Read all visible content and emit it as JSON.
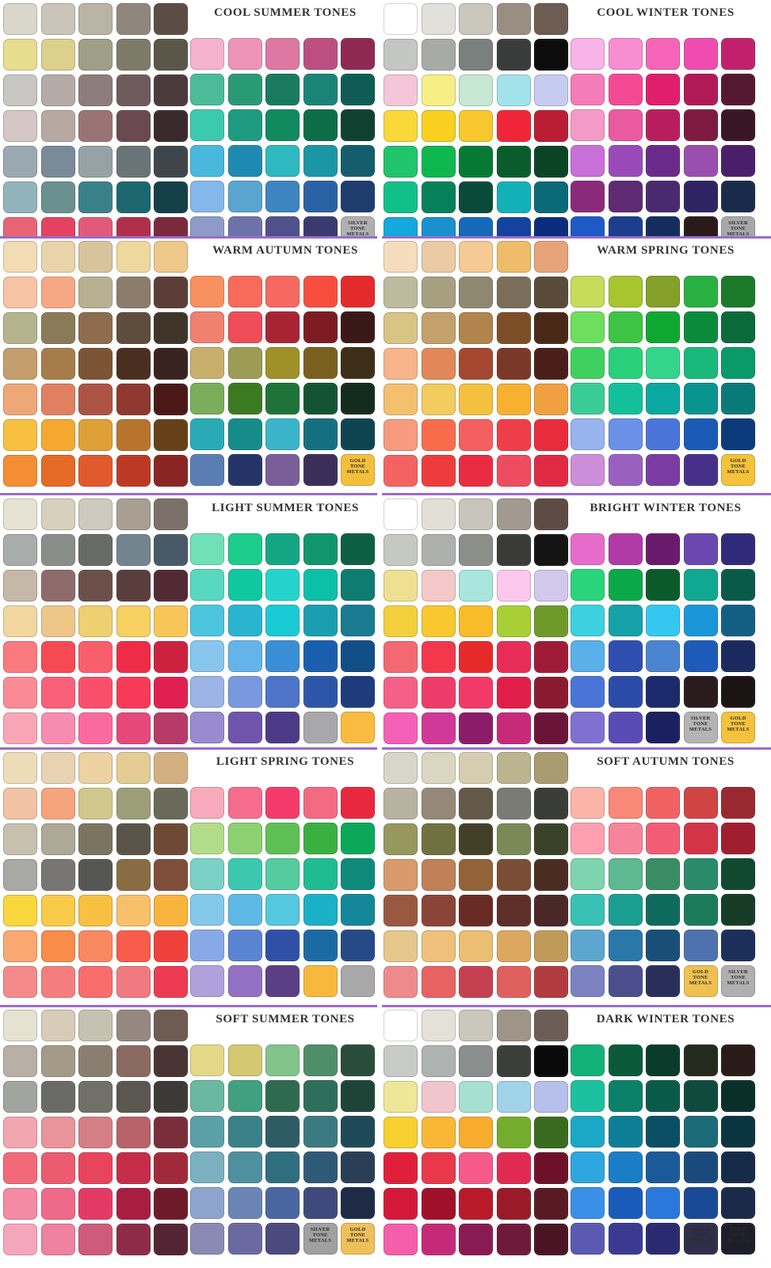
{
  "palettes": [
    {
      "title": "COOL SUMMER TONES",
      "left": [
        [
          "#d9d6cc",
          "#cac5b8",
          "#b9b4a4",
          "#8f877c",
          "#5b4d44"
        ],
        [
          "#e7dd8e",
          "#ddd08c",
          "#9e9f86",
          "#7c7a69",
          "#5a5748"
        ],
        [
          "#c8c6c2",
          "#b4aaa6",
          "#8c7c7c",
          "#6e5a5c",
          "#4a3a3c"
        ],
        [
          "#d6c6c6",
          "#b8a8a2",
          "#9a7474",
          "#6a4a50",
          "#3a2a2e"
        ],
        [
          "#9aa8b0",
          "#7a8a98",
          "#95a3a6",
          "#6a7478",
          "#3e464c"
        ],
        [
          "#90b4ba",
          "#6a9090",
          "#3a8088",
          "#1c6670",
          "#143e48"
        ],
        [
          "#e86474",
          "#e44260",
          "#e15a7a",
          "#b0304c",
          "#7a2a3c"
        ]
      ],
      "right": [
        [
          "#f4b2cc",
          "#ee94b8",
          "#dc78a2",
          "#bc4e80",
          "#8e2a52"
        ],
        [
          "#4cbc98",
          "#2a9a74",
          "#1a7a60",
          "#1a8478",
          "#0e5c54"
        ],
        [
          "#3ccaae",
          "#1e9a80",
          "#108a5e",
          "#0c6e48",
          "#104030"
        ],
        [
          "#48b8dc",
          "#1e8ab4",
          "#2eb8c0",
          "#1a96a4",
          "#145e6c"
        ],
        [
          "#84b8ea",
          "#5aa4d0",
          "#3e84c0",
          "#2a62a6",
          "#1e3c6e"
        ],
        [
          "#8e9ac8",
          "#6e72aa",
          "#50508a",
          "#3a3a6e",
          "#b0b0b0"
        ]
      ],
      "metals": [
        "",
        "",
        "",
        "",
        "SILVER TONE METALS"
      ]
    },
    {
      "title": "COOL WINTER TONES",
      "left": [
        [
          "#ffffff",
          "#e2e0da",
          "#cac8bc",
          "#9a8e82",
          "#6c5c52"
        ],
        [
          "#c4c6c4",
          "#a8aaa8",
          "#7a807e",
          "#3a3c3c",
          "#0c0c0c"
        ],
        [
          "#f4c6d8",
          "#f8ee86",
          "#c6e8d2",
          "#a2e2ea",
          "#c6ccf0"
        ],
        [
          "#fad83a",
          "#f8d020",
          "#f8c82e",
          "#ee2638",
          "#ba1c34"
        ],
        [
          "#20c46a",
          "#0eb84e",
          "#067a34",
          "#0a5c2c",
          "#0a4424"
        ],
        [
          "#10c088",
          "#068058",
          "#0a4a38",
          "#14b0b8",
          "#0a6a78"
        ],
        [
          "#14a8dc",
          "#1a90d0",
          "#146ab8",
          "#1442a0",
          "#0a2c7c"
        ]
      ],
      "right": [
        [
          "#f8b4e6",
          "#f88ed2",
          "#f664b8",
          "#f04cb0",
          "#c2206e"
        ],
        [
          "#f47cb8",
          "#f44a94",
          "#e01e6c",
          "#b01a56",
          "#541830"
        ],
        [
          "#f49ac8",
          "#ea5aa0",
          "#b81e5e",
          "#7e1a40",
          "#3a1624"
        ],
        [
          "#c870d8",
          "#9a4ab8",
          "#6a2a8a",
          "#9a4eb0",
          "#4a1e6a"
        ],
        [
          "#8a2a7a",
          "#5e2a72",
          "#4a2a6e",
          "#2e2464",
          "#1a2a4a"
        ],
        [
          "#1e5ac6",
          "#1a3e8c",
          "#142c5e",
          "#2a1a1a",
          "#a8a8a8"
        ]
      ],
      "metals": [
        "",
        "",
        "",
        "",
        "SILVER TONE METALS"
      ]
    },
    {
      "title": "WARM AUTUMN TONES",
      "left": [
        [
          "#f2dcb4",
          "#e8d4a8",
          "#d8c49c",
          "#eed89e",
          "#eec888"
        ],
        [
          "#f6c4a4",
          "#f6a884",
          "#b8b090",
          "#8c7c6c",
          "#5c3c36"
        ],
        [
          "#b6b48e",
          "#8a7a58",
          "#8e6c4e",
          "#5e4c3c",
          "#3e3428"
        ],
        [
          "#c49e6c",
          "#a67c4a",
          "#7a5434",
          "#4a2e20",
          "#3a2220"
        ],
        [
          "#eea878",
          "#e08060",
          "#ac5444",
          "#8e3830",
          "#4a1818"
        ],
        [
          "#f8c040",
          "#f4a830",
          "#e0a038",
          "#b8742c",
          "#664018"
        ],
        [
          "#f48e34",
          "#e46a26",
          "#e05a2c",
          "#bc3a24",
          "#8a2424"
        ]
      ],
      "right": [
        [
          "#f89060",
          "#f86a5a",
          "#f66860",
          "#f84e3e",
          "#e42a2a"
        ],
        [
          "#f08070",
          "#ee4c58",
          "#a82434",
          "#7c1c22",
          "#3a1818"
        ],
        [
          "#c8b06c",
          "#9c9c54",
          "#a09028",
          "#7a601e",
          "#3c2e18"
        ],
        [
          "#7aae5a",
          "#3c7a22",
          "#1e7438",
          "#145434",
          "#142c1e"
        ],
        [
          "#2aaab4",
          "#168c8a",
          "#3ab4c8",
          "#147080",
          "#0e4450"
        ],
        [
          "#5a7eb4",
          "#243466",
          "#7a5e9a",
          "#3c2e58",
          "#f4c03c"
        ]
      ],
      "metals": [
        "",
        "",
        "",
        "",
        "GOLD TONE METALS"
      ]
    },
    {
      "title": "WARM SPRING TONES",
      "left": [
        [
          "#f4dcbc",
          "#eccaa4",
          "#f6ca94",
          "#eebc6a",
          "#e6a478"
        ],
        [
          "#beba9e",
          "#a6a080",
          "#8e8870",
          "#7a6e5a",
          "#5a4a3a"
        ],
        [
          "#d8c484",
          "#c4a06a",
          "#b0844c",
          "#7c4e28",
          "#4a2818"
        ],
        [
          "#f8b48a",
          "#e28858",
          "#a44630",
          "#7a3828",
          "#4a1e1a"
        ],
        [
          "#f4c070",
          "#f2cc5e",
          "#f4c040",
          "#f8b030",
          "#f0a040"
        ],
        [
          "#f89a7e",
          "#f86c4c",
          "#f46060",
          "#f03e48",
          "#e82c3c"
        ],
        [
          "#f46262",
          "#ee3c3c",
          "#ea2c42",
          "#ee4c60",
          "#e02a44"
        ]
      ],
      "right": [
        [
          "#c6dc5a",
          "#a8c42e",
          "#84a028",
          "#28b040",
          "#1a7a2a"
        ],
        [
          "#6ede5e",
          "#3ec444",
          "#0ea830",
          "#0a8a3a",
          "#0a6a3a"
        ],
        [
          "#40d060",
          "#2ad07a",
          "#34d48c",
          "#1ab87a",
          "#0a9a6a"
        ],
        [
          "#3acc98",
          "#14c09a",
          "#0aa8a0",
          "#0a9490",
          "#0a7a78"
        ],
        [
          "#98b4ee",
          "#6a90e8",
          "#4a74d8",
          "#1a5ab4",
          "#0a3a7a"
        ],
        [
          "#cc8ed8",
          "#9a60c0",
          "#7a3ca0",
          "#46308a",
          "#f6c23a"
        ]
      ],
      "metals": [
        "",
        "",
        "",
        "",
        "GOLD TONE METALS"
      ]
    },
    {
      "title": "LIGHT SUMMER TONES",
      "left": [
        [
          "#e6e2d2",
          "#d6d0bc",
          "#cecac0",
          "#a89e92",
          "#7c706a"
        ],
        [
          "#a8acaa",
          "#8a8e8a",
          "#686a68",
          "#72848e",
          "#485a68"
        ],
        [
          "#c6b8a8",
          "#8e6a6a",
          "#6a5048",
          "#5a3e3e",
          "#522a36"
        ],
        [
          "#f2d6a0",
          "#eec688",
          "#eed070",
          "#f6d060",
          "#f8c658"
        ],
        [
          "#fa7a80",
          "#f64a52",
          "#f85e6c",
          "#ee2c48",
          "#cc2240"
        ],
        [
          "#fa8a96",
          "#f8607a",
          "#f8506c",
          "#f63a58",
          "#e02050"
        ],
        [
          "#f8a6b6",
          "#f88cb0",
          "#fa6a9e",
          "#e6487a",
          "#b83a66"
        ]
      ],
      "right": [
        [
          "#70e0b8",
          "#1ccc8c",
          "#14a682",
          "#10966a",
          "#0e5e44"
        ],
        [
          "#58d8c0",
          "#10c8a0",
          "#24d4cc",
          "#0cc0a8",
          "#0e7c70"
        ],
        [
          "#4cc6de",
          "#2ab4d0",
          "#1acad4",
          "#1a9eb0",
          "#1a7a90"
        ],
        [
          "#88c6ee",
          "#64b4ea",
          "#3a8ed6",
          "#1a5eae",
          "#124e86"
        ],
        [
          "#9cb4e6",
          "#7a98de",
          "#4e74ca",
          "#2e56a8",
          "#1e3c7c"
        ],
        [
          "#9a8ad0",
          "#6e54aa",
          "#4c3a86",
          "#a8a8ac",
          "#fabc40"
        ]
      ],
      "metals": [
        "",
        "",
        "",
        "",
        ""
      ]
    },
    {
      "title": "BRIGHT WINTER TONES",
      "left": [
        [
          "#ffffff",
          "#e2e0d6",
          "#c8c6bc",
          "#a29a90",
          "#5c4c44"
        ],
        [
          "#c6c8c2",
          "#aeb0ae",
          "#8c8e8a",
          "#3a3a38",
          "#141414"
        ],
        [
          "#eee090",
          "#f4c8c8",
          "#a8e6de",
          "#fcc8ec",
          "#d2c8ec"
        ],
        [
          "#f4d03c",
          "#f8c82e",
          "#f8bc2a",
          "#a8d036",
          "#6e9a2a"
        ],
        [
          "#f46872",
          "#f4384c",
          "#e62a2a",
          "#e82c5a",
          "#9e1a36"
        ],
        [
          "#f46088",
          "#ee3c6a",
          "#f23a68",
          "#e01e4a",
          "#8a1a30"
        ],
        [
          "#f460b8",
          "#d23898",
          "#8a1c68",
          "#c82a7a",
          "#6a1438"
        ]
      ],
      "right": [
        [
          "#e66ccc",
          "#b03aa6",
          "#6a1a6a",
          "#6a48b0",
          "#302a7a"
        ],
        [
          "#2ad47a",
          "#0aa848",
          "#0a5a2a",
          "#10a890",
          "#0a5a4a"
        ],
        [
          "#3cd0e0",
          "#16a0a8",
          "#34c8f0",
          "#1a96d8",
          "#145e84"
        ],
        [
          "#5ab0e8",
          "#2e4eb0",
          "#4a84d0",
          "#1e5ab8",
          "#1a2a5e"
        ],
        [
          "#4a74d8",
          "#2a4ca8",
          "#1a2a6a",
          "#2a1c1c",
          "#1c1414"
        ],
        [
          "#8070d0",
          "#5a4ab4",
          "#1a2060",
          "#b4b4b4",
          "#f4c23c"
        ]
      ],
      "metals": [
        "",
        "",
        "",
        "SILVER TONE METALS",
        "GOLD TONE METALS"
      ]
    },
    {
      "title": "LIGHT SPRING TONES",
      "left": [
        [
          "#eedcb8",
          "#e8d2b2",
          "#ecd2a0",
          "#e4cc94",
          "#d4b080"
        ],
        [
          "#f2c2a4",
          "#f6a47c",
          "#d2c88e",
          "#9c9e78",
          "#6a6a58"
        ],
        [
          "#c8c0ae",
          "#aea898",
          "#7a7460",
          "#5a5448",
          "#6e4a34"
        ],
        [
          "#a8a8a4",
          "#787674",
          "#565654",
          "#8a6c44",
          "#7e4e3a"
        ],
        [
          "#f8d63c",
          "#f8ca4a",
          "#f8c040",
          "#f8c06a",
          "#f8b43c"
        ],
        [
          "#f8a870",
          "#f88c48",
          "#f88860",
          "#f85c4a",
          "#f0403c"
        ],
        [
          "#f48a8a",
          "#f47e7e",
          "#f86c6c",
          "#f07a80",
          "#ec3a52"
        ]
      ],
      "right": [
        [
          "#f8aabc",
          "#f66c8c",
          "#f43a6a",
          "#f46a80",
          "#e8283e"
        ],
        [
          "#b2dc88",
          "#8cd072",
          "#5ec054",
          "#3ab040",
          "#0aa858"
        ],
        [
          "#7ad2c6",
          "#3cc8b0",
          "#54cca0",
          "#1ebc90",
          "#0e8a7a"
        ],
        [
          "#84c8ea",
          "#5eb8e6",
          "#54c8de",
          "#1ab0c8",
          "#14869a"
        ],
        [
          "#88a8e8",
          "#5a84d2",
          "#3050a8",
          "#1a6aa4",
          "#264a88"
        ],
        [
          "#b0a0dc",
          "#9270c4",
          "#5a3e86",
          "#f8b83c",
          "#a8a8a8"
        ]
      ],
      "metals": [
        "",
        "",
        "",
        "",
        ""
      ]
    },
    {
      "title": "SOFT AUTUMN TONES",
      "left": [
        [
          "#d8d6c8",
          "#dad6c0",
          "#d6ccb0",
          "#bcb48e",
          "#a89c70"
        ],
        [
          "#b8b2a0",
          "#968878",
          "#645848",
          "#7a7c74",
          "#3a3c38"
        ],
        [
          "#96985e",
          "#707040",
          "#444028",
          "#7a8a56",
          "#3a4228"
        ],
        [
          "#d89a6a",
          "#c08058",
          "#946238",
          "#7a4e34",
          "#4a2c20"
        ],
        [
          "#9a5840",
          "#8a4438",
          "#6a2a24",
          "#5e2e28",
          "#4a2828"
        ],
        [
          "#e6c88c",
          "#f0c07a",
          "#ecbe72",
          "#dca860",
          "#c09a58"
        ],
        [
          "#ee8a8a",
          "#e86262",
          "#c44050",
          "#e06060",
          "#b03c40"
        ]
      ],
      "right": [
        [
          "#fcb4a8",
          "#f88878",
          "#f06262",
          "#d04444",
          "#9a2830"
        ],
        [
          "#fca0b0",
          "#f6849a",
          "#f25c74",
          "#d43448",
          "#a01e30"
        ],
        [
          "#7ed4ae",
          "#5eb890",
          "#3a8c64",
          "#2a8a6a",
          "#104830"
        ],
        [
          "#38c0b4",
          "#1a9e90",
          "#0e6a5c",
          "#1a7a5a",
          "#163c26"
        ],
        [
          "#5ca6d0",
          "#2a78a8",
          "#184e78",
          "#4e72b0",
          "#1c2e5a"
        ],
        [
          "#7a82c0",
          "#4a4e8c",
          "#2a2e5a",
          "#f0c050",
          "#b0b0b0"
        ]
      ],
      "metals": [
        "",
        "",
        "",
        "GOLD TONE METALS",
        "SILVER TONE METALS"
      ]
    },
    {
      "title": "SOFT SUMMER TONES",
      "left": [
        [
          "#e6e2d2",
          "#d8ccb8",
          "#c6c2b2",
          "#968880",
          "#6e5c52"
        ],
        [
          "#b8b0a6",
          "#a49a88",
          "#8a7e70",
          "#8a6a60",
          "#4a3434"
        ],
        [
          "#a2a4a0",
          "#6a6a66",
          "#707068",
          "#5a5650",
          "#3c3a36"
        ],
        [
          "#f2a6b0",
          "#e8949a",
          "#d67e86",
          "#b8626a",
          "#7a2e3a"
        ],
        [
          "#f26a7a",
          "#ec5c70",
          "#e8445c",
          "#c42c48",
          "#a02a3a"
        ],
        [
          "#f48aa4",
          "#ee6a88",
          "#e23a64",
          "#a81e40",
          "#6e1a2a"
        ],
        [
          "#f6a6bc",
          "#ee82a0",
          "#ce5a7c",
          "#8e2a4a",
          "#522434"
        ]
      ],
      "right": [
        [
          "#e4d888",
          "#d4c870",
          "#82c48a",
          "#4e8e68",
          "#2a4c3a"
        ],
        [
          "#6ab8a2",
          "#40a080",
          "#2e6a50",
          "#2e6e5a",
          "#1e4438"
        ],
        [
          "#5aa0a6",
          "#3a8088",
          "#2e5c64",
          "#3a7a80",
          "#1e4a58"
        ],
        [
          "#7ab0c0",
          "#4e90a0",
          "#2e6e7e",
          "#2e5a78",
          "#2a3e56"
        ],
        [
          "#8ea4cc",
          "#6a84b6",
          "#4a66a0",
          "#3e4a7c",
          "#1e2a46"
        ],
        [
          "#8a8ab4",
          "#6a6aa0",
          "#4a4a7e",
          "#a0a0a0",
          "#eec05a"
        ]
      ],
      "metals": [
        "",
        "",
        "",
        "SILVER TONE METALS",
        "GOLD TONE METALS"
      ]
    },
    {
      "title": "DARK WINTER TONES",
      "left": [
        [
          "#ffffff",
          "#e4e2d8",
          "#cac8bc",
          "#9e9488",
          "#6c5e54"
        ],
        [
          "#c8cac8",
          "#aeb2b0",
          "#8a8e8c",
          "#3c3e3c",
          "#0a0a0a"
        ],
        [
          "#eee698",
          "#f0c6cc",
          "#a6e0d0",
          "#a0d2e8",
          "#b6c0ea"
        ],
        [
          "#f8d030",
          "#f8b836",
          "#f8ac2e",
          "#74ac2e",
          "#3a6a1e"
        ],
        [
          "#e0203a",
          "#e8384a",
          "#f65a8a",
          "#e02a52",
          "#6e1028"
        ],
        [
          "#d4183a",
          "#a01028",
          "#b81a2a",
          "#9a1a2a",
          "#5a1a24"
        ],
        [
          "#f45eaa",
          "#c42a78",
          "#8a1a52",
          "#6e1a38",
          "#4a1424"
        ]
      ],
      "right": [
        [
          "#14b07a",
          "#0a5a3a",
          "#0a3a2a",
          "#242a1e",
          "#2a1a18"
        ],
        [
          "#1cc0a0",
          "#0a8068",
          "#0a5a4a",
          "#104a3e",
          "#0a2e2a"
        ],
        [
          "#1aa8c6",
          "#0e7e96",
          "#0a4e64",
          "#1a6a78",
          "#0a3440"
        ],
        [
          "#2ea6e0",
          "#1a7ec6",
          "#1a5a98",
          "#1a4a7c",
          "#142a48"
        ],
        [
          "#3a90e6",
          "#1a5ab8",
          "#2a78dc",
          "#1a4a96",
          "#1a2a48"
        ],
        [
          "#5a5ab0",
          "#3a3a90",
          "#2a2a70",
          "#2e2e4a",
          "#1e1e2a"
        ]
      ],
      "metals": [
        "",
        "",
        "",
        "SILVER TONE METALS",
        "GOLD TONE METALS"
      ]
    }
  ]
}
